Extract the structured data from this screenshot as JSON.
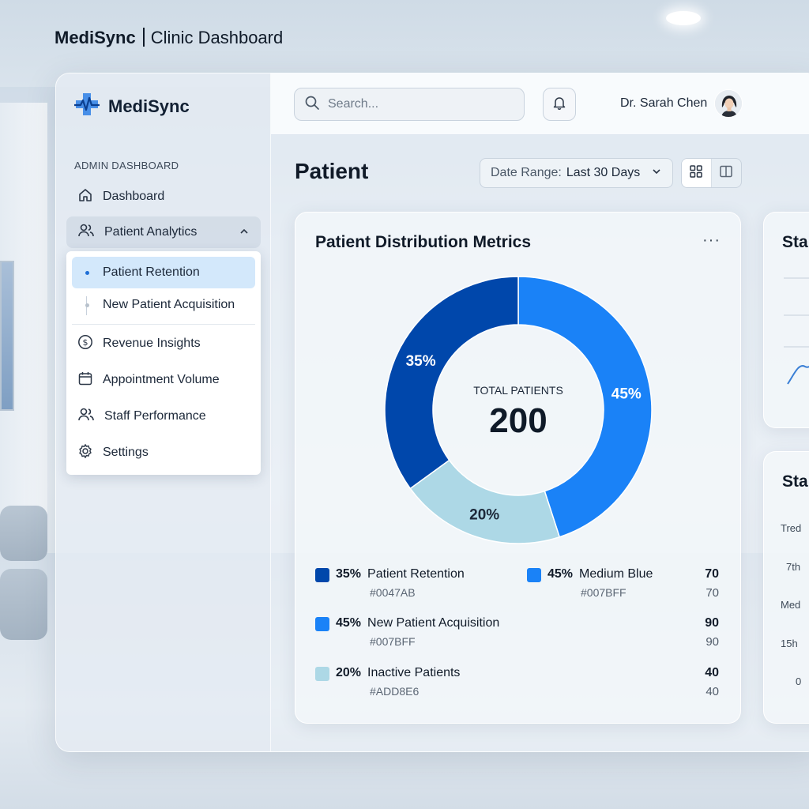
{
  "page_title": {
    "brand": "MediSync",
    "subtitle": "Clinic Dashboard"
  },
  "sidebar": {
    "logo_text": "MediSync",
    "section_label": "ADMIN DASHBOARD",
    "items": [
      {
        "label": "Dashboard",
        "icon": "home-icon"
      },
      {
        "label": "Patient Analytics",
        "icon": "users-icon",
        "expanded": true
      }
    ],
    "submenu": {
      "sub_items": [
        {
          "label": "Patient Retention",
          "active": true
        },
        {
          "label": "New Patient Acquisition",
          "active": false
        }
      ],
      "items": [
        {
          "label": "Revenue Insights",
          "icon": "dollar-circle-icon"
        },
        {
          "label": "Appointment Volume",
          "icon": "calendar-icon"
        },
        {
          "label": "Staff Performance",
          "icon": "users-icon"
        },
        {
          "label": "Settings",
          "icon": "gear-icon"
        }
      ]
    }
  },
  "topbar": {
    "search_placeholder": "Search...",
    "user_name": "Dr. Sarah Chen"
  },
  "content": {
    "title": "Patient",
    "date_range_label": "Date Range:",
    "date_range_value": "Last 30 Days"
  },
  "card": {
    "title": "Patient Distribution Metrics",
    "menu": "···",
    "center_label": "TOTAL PATIENTS",
    "center_value": "200"
  },
  "chart_data": {
    "type": "pie",
    "title": "Patient Distribution Metrics",
    "slices": [
      {
        "label": "Patient Retention",
        "value": 35,
        "color": "#0047AB"
      },
      {
        "label": "Medium Blue",
        "value": 45,
        "color": "#1a82f7"
      },
      {
        "label": "Inactive Patients",
        "value": 20,
        "color": "#ADD8E6"
      }
    ],
    "slice_labels": [
      "35%",
      "45%",
      "20%"
    ],
    "total": 200
  },
  "legend": [
    {
      "pct": "35%",
      "label": "Patient Retention",
      "hex": "#0047AB",
      "color": "#0047AB",
      "value": "70",
      "value2": "70"
    },
    {
      "pct": "45%",
      "label": "Medium Blue",
      "hex": "#007BFF",
      "color": "#1a82f7",
      "value": "70",
      "value2": "70"
    },
    {
      "pct": "45%",
      "label": "New Patient Acquisition",
      "hex": "#007BFF",
      "color": "#1a82f7",
      "value": "90",
      "value2": "90"
    },
    {
      "pct": "20%",
      "label": "Inactive Patients",
      "hex": "#ADD8E6",
      "color": "#ADD8E6",
      "value": "40",
      "value2": "40"
    }
  ],
  "side_cards": {
    "top_title": "Sta",
    "bottom_title": "Sta",
    "bottom_labels": [
      "Tred",
      "7th",
      "Med",
      "15h",
      "0"
    ]
  }
}
